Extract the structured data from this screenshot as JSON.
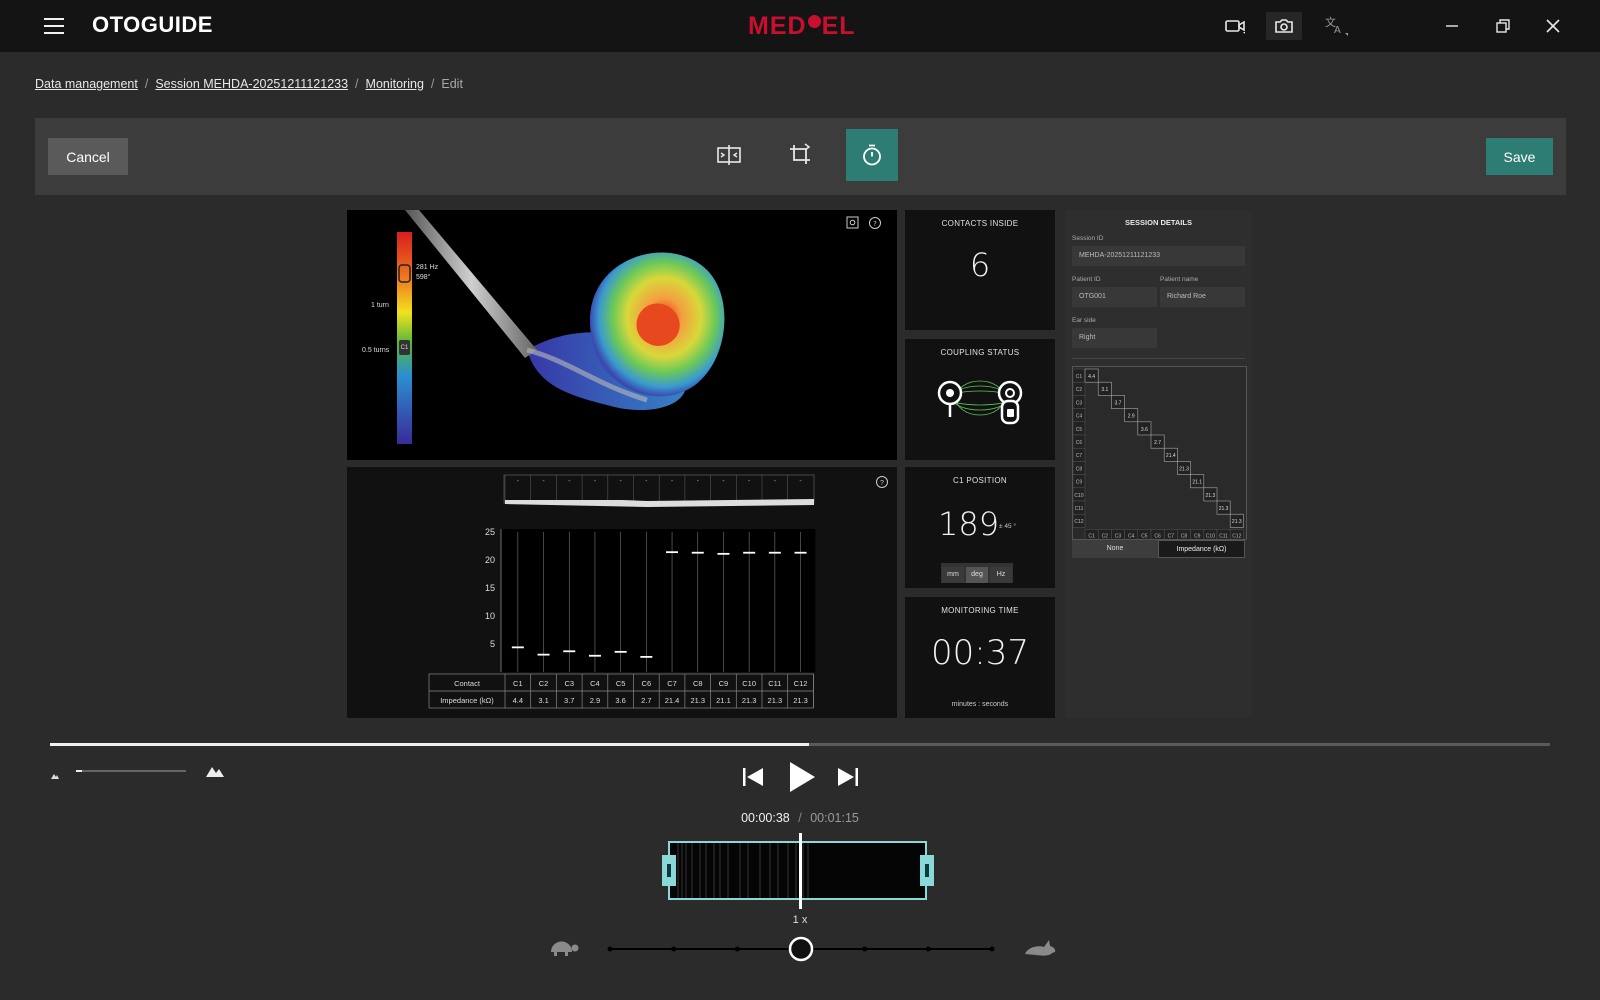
{
  "app": {
    "title": "OTOGUIDE",
    "brand_left": "MED",
    "brand_right": "EL"
  },
  "icons": {
    "menu": "hamburger-icon",
    "camera": "camera-icon",
    "record": "video-record-icon",
    "language": "translate-icon",
    "minimize": "minimize-icon",
    "restore": "restore-icon",
    "close": "close-icon"
  },
  "breadcrumb": {
    "items": [
      "Data management",
      "Session MEHDA-20251211121233",
      "Monitoring"
    ],
    "current": "Edit"
  },
  "toolbar": {
    "cancel_label": "Cancel",
    "save_label": "Save"
  },
  "viewer3d": {
    "freq_label": "281 Hz",
    "angle_label": "598°",
    "turn1_label": "1 turn",
    "turn05_label": "0.5 turns",
    "c1_marker": "C1"
  },
  "contacts_inside": {
    "title": "CONTACTS INSIDE",
    "value": "6"
  },
  "coupling": {
    "title": "COUPLING STATUS"
  },
  "c1_position": {
    "title": "C1 POSITION",
    "value": "189",
    "tolerance": "± 45 °",
    "units": [
      "mm",
      "deg",
      "Hz"
    ],
    "selected_unit": "deg"
  },
  "monitoring_time": {
    "title": "MONITORING TIME",
    "value": "00:37",
    "caption": "minutes : seconds"
  },
  "session": {
    "title": "SESSION DETAILS",
    "session_id_label": "Session ID",
    "session_id": "MEHDA-20251211121233",
    "patient_id_label": "Patient ID",
    "patient_id": "OTG001",
    "patient_name_label": "Patient name",
    "patient_name": "Richard Roe",
    "ear_side_label": "Ear side",
    "ear_side": "Right",
    "matrix_values": [
      "4.4",
      "3.1",
      "3.7",
      "2.9",
      "3.6",
      "2.7",
      "21.4",
      "21.3",
      "21.1",
      "21.3",
      "21.3",
      "21.3"
    ],
    "toggle": [
      "None",
      "Impedance (kΩ)"
    ],
    "toggle_selected": "Impedance (kΩ)"
  },
  "chart_data": {
    "type": "table",
    "title": "",
    "categories": [
      "C1",
      "C2",
      "C3",
      "C4",
      "C5",
      "C6",
      "C7",
      "C8",
      "C9",
      "C10",
      "C11",
      "C12"
    ],
    "series": [
      {
        "name": "Impedance (kΩ)",
        "values": [
          4.4,
          3.1,
          3.7,
          2.9,
          3.6,
          2.7,
          21.4,
          21.3,
          21.1,
          21.3,
          21.3,
          21.3
        ]
      }
    ],
    "yticks": [
      5,
      10,
      15,
      20,
      25
    ],
    "ylim": [
      0,
      25
    ],
    "row_header_contact": "Contact",
    "row_header_value": "Impedance (kΩ)",
    "value_labels": [
      "4.4",
      "3.1",
      "3.7",
      "2.9",
      "3.6",
      "2.7",
      "21.4",
      "21.3",
      "21.1",
      "21.3",
      "21.3",
      "21.3"
    ],
    "strip_labels": [
      "-",
      "-",
      "-",
      "-",
      "-",
      "-",
      "-",
      "-",
      "-",
      "-",
      "-",
      "-"
    ]
  },
  "player": {
    "progress": 0.506,
    "current_time": "00:00:38",
    "separator": "/",
    "total_time": "00:01:15",
    "speed": "1 x",
    "speed_level": 3,
    "speed_steps": 7,
    "brightness": 0.05
  }
}
